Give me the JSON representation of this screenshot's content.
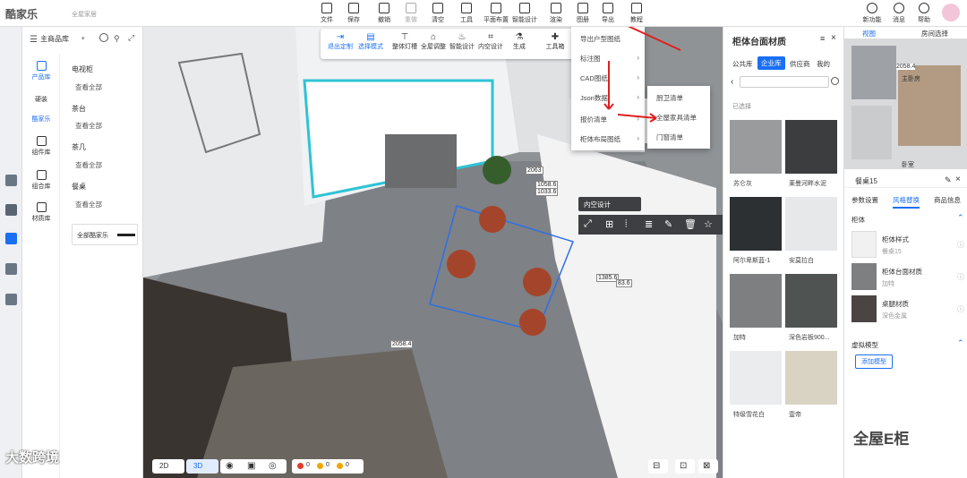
{
  "app": {
    "logo": "酷家乐",
    "logo_sub": "全屋家居"
  },
  "toolbar": {
    "items": [
      "文件",
      "保存",
      "撤销",
      "重做",
      "清空",
      "工具",
      "平面布置",
      "智能设计",
      "渲染",
      "图册",
      "导出",
      "教程"
    ]
  },
  "topright": {
    "items": [
      "新功能",
      "消息",
      "帮助"
    ]
  },
  "left_rail": {
    "icons": [
      "product-icon",
      "home-icon",
      "apartment-icon",
      "model-icon",
      "person-icon",
      "print-icon"
    ]
  },
  "product_panel": {
    "dropdown": "主商品库",
    "categories": [
      {
        "label": "产品库",
        "active": true
      },
      {
        "label": "硬装",
        "active": false
      },
      {
        "label": "酷家乐",
        "active": true
      },
      {
        "label": "组件库",
        "active": false
      },
      {
        "label": "组合库",
        "active": false
      },
      {
        "label": "材质库",
        "active": false
      }
    ],
    "sections": [
      {
        "title": "电视柜",
        "link": "查看全部"
      },
      {
        "title": "茶台",
        "link": "查看全部"
      },
      {
        "title": "茶几",
        "link": "查看全部"
      },
      {
        "title": "餐桌",
        "link": "查看全部"
      }
    ],
    "all_button": "全部酷家乐"
  },
  "viewport": {
    "edit_toolbar": [
      "退出定制",
      "选择模式",
      "整体灯槽",
      "全屋调整",
      "智能设计",
      "内空设计",
      "生成",
      "工具箱"
    ],
    "dimensions": [
      "2063",
      "1058.6",
      "1033.6",
      "1385.6",
      "83.6",
      "2058.4"
    ],
    "context_label": "内空设计",
    "export_menu": [
      "导出户型图纸",
      "标注图",
      "CAD图纸",
      "Json数据",
      "报价清单",
      "柜体布局图纸"
    ],
    "export_submenu": [
      "厨卫清单",
      "全屋家具清单",
      "门窗清单"
    ],
    "bottom": {
      "mode_2d": "2D",
      "mode_3d": "3D",
      "counts": [
        "0",
        "0",
        "0"
      ],
      "watermark": "大数跨境"
    }
  },
  "material_panel": {
    "title": "柜体台面材质",
    "tabs": [
      "公共库",
      "企业库",
      "供应商",
      "我的"
    ],
    "active_tab": "企业库",
    "breadcrumb": "已选择",
    "swatches": [
      {
        "label": "苏仑灰",
        "color": "#9a9b9c"
      },
      {
        "label": "莱曼河畔水泥",
        "color": "#3b3d3e"
      },
      {
        "label": "阿尔卑斯蓝-1",
        "color": "#2c3032"
      },
      {
        "label": "安莫拉白",
        "color": "#e7e8ea"
      },
      {
        "label": "加特",
        "color": "#7d7f80"
      },
      {
        "label": "深色岩板900...",
        "color": "#4f5452"
      },
      {
        "label": "特级雪花白",
        "color": "#ebecee"
      },
      {
        "label": "壹帝",
        "color": "#d9d3c4"
      }
    ]
  },
  "right_panel": {
    "tabs": [
      "视图",
      "房间选择"
    ],
    "plan_labels": [
      "2058.4",
      "主卧房",
      "卧室"
    ],
    "props_title": "餐桌15",
    "props_tabs": [
      "参数设置",
      "风格替换",
      "商品信息"
    ],
    "active_props_tab": "风格替换",
    "group_label": "柜体",
    "rows": [
      {
        "name": "柜体样式",
        "sub": "餐桌15"
      },
      {
        "name": "柜体台面材质",
        "sub": "加特"
      },
      {
        "name": "桌腿材质",
        "sub": "深色金属"
      }
    ],
    "model_label": "虚拟模型",
    "add_button": "添加模型",
    "watermark": "全屋E柜"
  }
}
